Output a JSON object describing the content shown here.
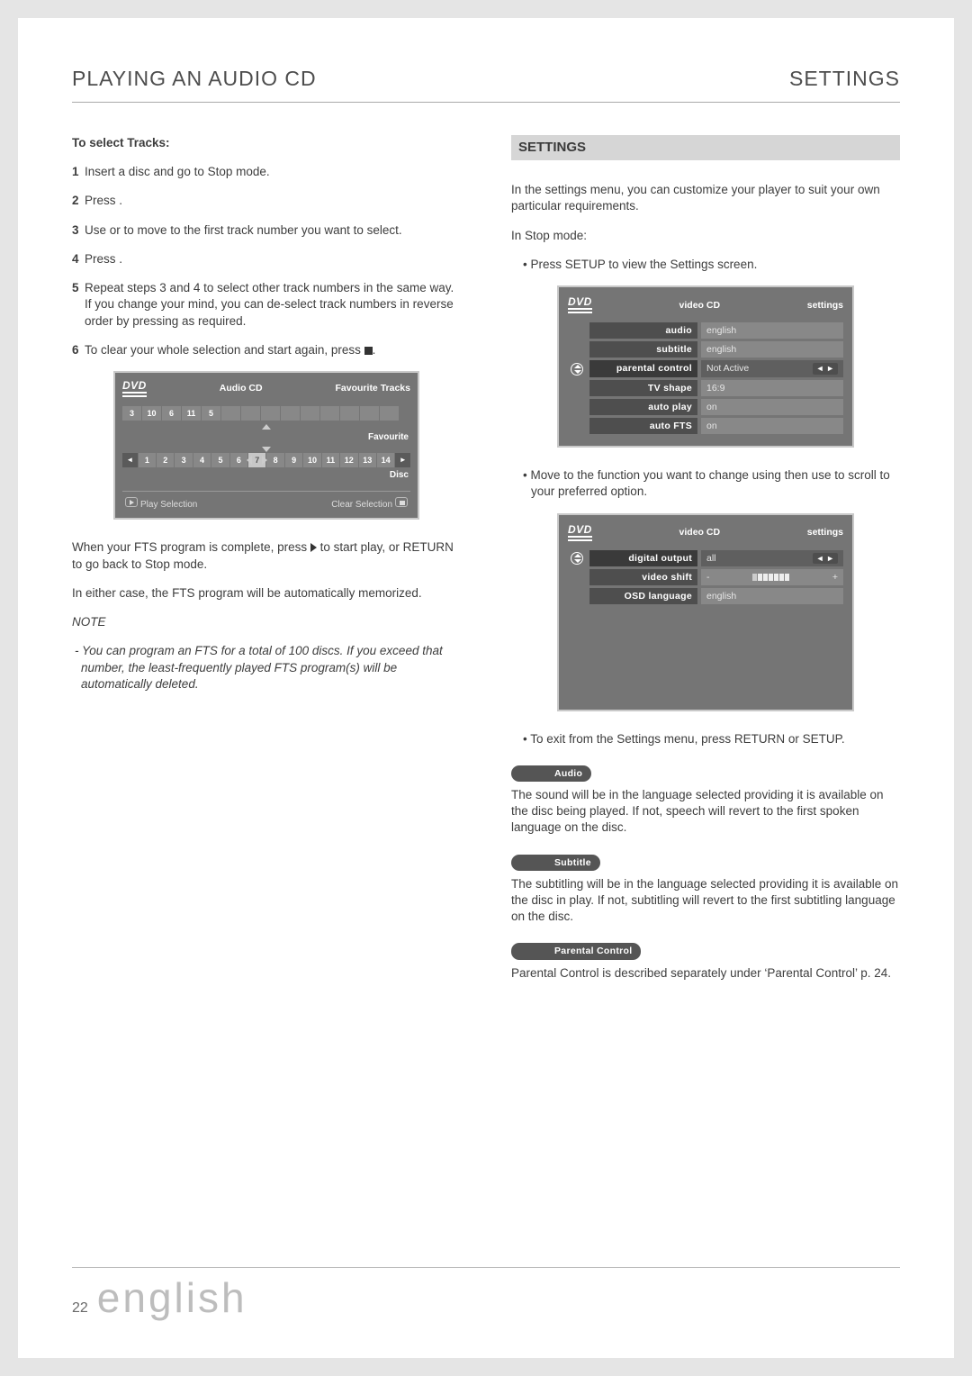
{
  "header": {
    "left": "PLAYING AN AUDIO CD",
    "right": "SETTINGS"
  },
  "left": {
    "h": "To select Tracks:",
    "s1": "Insert a disc and go to Stop mode.",
    "s2": "Press      .",
    "s3": "Use       or       to move to the first track number you want to select.",
    "s4": "Press      .",
    "s5": "Repeat steps 3 and 4 to select other track numbers in the same way. If you change your mind, you can de-select track numbers in reverse order by pressing       as required.",
    "s6a": "To clear your whole selection and start again, press ",
    "s6b": ".",
    "after1": "When your FTS program is complete, press ",
    "after1b": " to start play, or RETURN to go back to Stop mode.",
    "after2": "In either case, the FTS program will be automatically memorized.",
    "noteH": "NOTE",
    "note": "- You can program an FTS for a total of 100 discs. If you exceed that number, the least-frequently played FTS program(s) will be automatically deleted.",
    "osd": {
      "title_mid": "Audio CD",
      "title_r": "Favourite Tracks",
      "fav": [
        "3",
        "10",
        "6",
        "11",
        "5"
      ],
      "favLabel": "Favourite",
      "disc": [
        "1",
        "2",
        "3",
        "4",
        "5",
        "6",
        "7",
        "8",
        "9",
        "10",
        "11",
        "12",
        "13",
        "14"
      ],
      "discLabel": "Disc",
      "playSel": "Play Selection",
      "clearSel": "Clear Selection"
    }
  },
  "right": {
    "bar": "SETTINGS",
    "intro": "In the settings menu, you can customize your player to suit your own particular requirements.",
    "stop": "In Stop mode:",
    "b1": "•  Press SETUP to view the Settings screen.",
    "b2a": "•  Move to the function you want to change using            then use          to scroll to your preferred option.",
    "b3": "•  To exit from the Settings menu, press RETURN or SETUP.",
    "osd1": {
      "mid": "video CD",
      "rgt": "settings",
      "rows": [
        {
          "l": "audio",
          "v": "english"
        },
        {
          "l": "subtitle",
          "v": "english"
        },
        {
          "l": "parental control",
          "v": "Not Active",
          "sel": true,
          "arrows": true,
          "icon": true
        },
        {
          "l": "TV shape",
          "v": "16:9"
        },
        {
          "l": "auto play",
          "v": "on"
        },
        {
          "l": "auto FTS",
          "v": "on"
        }
      ]
    },
    "osd2": {
      "mid": "video CD",
      "rgt": "settings",
      "rows": [
        {
          "l": "digital output",
          "v": "all",
          "sel": true,
          "arrows": true,
          "icon": true
        },
        {
          "l": "video shift",
          "v": "slider"
        },
        {
          "l": "OSD language",
          "v": "english"
        }
      ]
    },
    "pillAudio": "Audio",
    "pAudio": "The sound will be in the language selected providing it is available on the disc being played. If not, speech will revert to the first spoken language on the disc.",
    "pillSub": "Subtitle",
    "pSub": "The subtitling will be in the language selected providing it is available on the disc in play. If not, subtitling will revert to the first subtitling language on the disc.",
    "pillPar": "Parental Control",
    "pPar": "Parental Control is described separately under ‘Parental Control’ p. 24."
  },
  "footer": {
    "num": "22",
    "lang": "english"
  }
}
